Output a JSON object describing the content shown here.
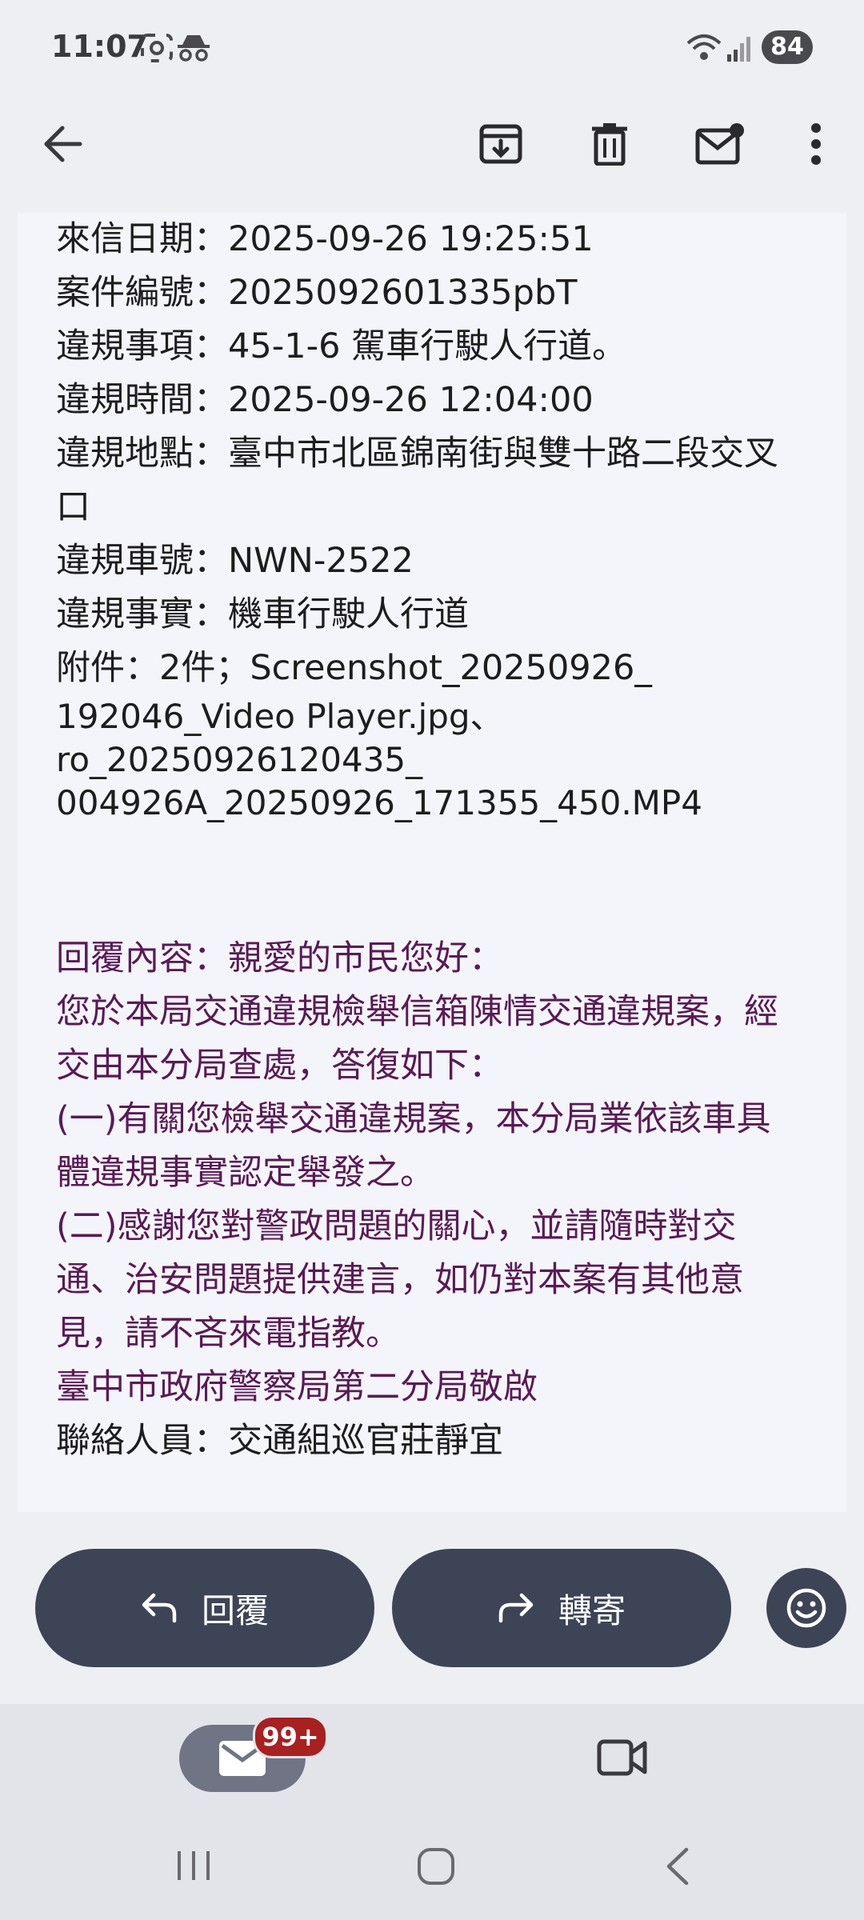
{
  "status": {
    "time": "11:07",
    "battery": "84"
  },
  "email": {
    "lines": [
      "來信日期：2025-09-26 19:25:51",
      "案件編號：2025092601335pbT",
      "違規事項：45-1-6 駕車行駛人行道。",
      "違規時間：2025-09-26 12:04:00",
      "違規地點：臺中市北區錦南街與雙十路二段交叉",
      "口",
      "違規車號：NWN-2522",
      "違規事實：機車行駛人行道"
    ],
    "attachment_lines": [
      "附件：2件；Screenshot_20250926_",
      "192046_Video Player.jpg、",
      "ro_20250926120435_",
      "004926A_20250926_171355_450.MP4"
    ],
    "reply_lines": [
      "回覆內容：親愛的市民您好：",
      "您於本局交通違規檢舉信箱陳情交通違規案，經",
      "交由本分局查處，答復如下：",
      "(一)有關您檢舉交通違規案，本分局業依該車具",
      "體違規事實認定舉發之。",
      "(二)感謝您對警政問題的關心，並請隨時對交",
      "通、治安問題提供建言，如仍對本案有其他意",
      "見，請不吝來電指教。",
      "臺中市政府警察局第二分局敬啟"
    ],
    "contact_line": "聯絡人員：交通組巡官莊靜宜"
  },
  "actions": {
    "reply_label": "回覆",
    "forward_label": "轉寄"
  },
  "bottom_nav": {
    "mail_badge": "99+"
  },
  "colors": {
    "reply_text": "#5a1a55",
    "action_button": "#3d4456",
    "badge": "#a8201f"
  }
}
